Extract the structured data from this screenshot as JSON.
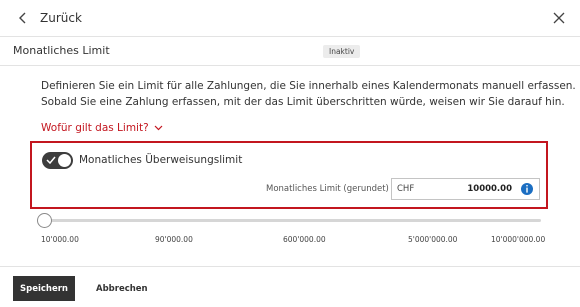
{
  "topbar": {
    "back_label": "Zurück",
    "back_icon": "chevron-left-icon",
    "close_icon": "close-icon"
  },
  "header": {
    "title": "Monatliches Limit",
    "status": "Inaktiv"
  },
  "description": {
    "line1": "Definieren Sie ein Limit für alle Zahlungen, die Sie innerhalb eines Kalendermonats manuell erfassen.",
    "line2": "Sobald Sie eine Zahlung erfassen, mit der das Limit überschritten würde, weisen wir Sie darauf hin."
  },
  "info_link": {
    "label": "Wofür gilt das Limit?",
    "icon": "chevron-down-icon"
  },
  "limit_panel": {
    "toggle_label": "Monatliches Überweisungslimit",
    "toggle_on": true,
    "field_label": "Monatliches Limit (gerundet)",
    "currency": "CHF",
    "amount": "10000.00",
    "info_icon": "info-icon"
  },
  "slider": {
    "value": 10000,
    "ticks": [
      "10'000.00",
      "90'000.00",
      "600'000.00",
      "5'000'000.00",
      "10'000'000.00"
    ]
  },
  "footer": {
    "save_label": "Speichern",
    "cancel_label": "Abbrechen"
  },
  "colors": {
    "accent": "#c3161f",
    "primary_button": "#333333",
    "info": "#1b6ec2"
  }
}
